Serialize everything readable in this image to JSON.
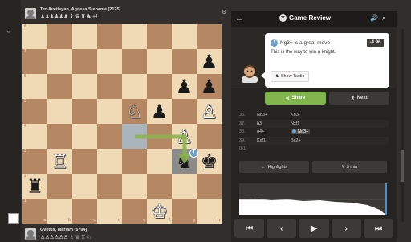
{
  "left_rail": {
    "mark": "«"
  },
  "player_top": {
    "name": "Ter-Avetisyan, Agnesa Stepania (2125)",
    "captures": "♟♟♟♟♟♟ ♝ ♛ ♜ ♞ +1"
  },
  "player_bottom": {
    "name": "Gvetus, Mariam (5794)",
    "captures": "♙♙♙♙♙♙ ♗ ♕ ♖ ♘"
  },
  "board": {
    "ranks": [
      "8",
      "7",
      "6",
      "5",
      "4",
      "3",
      "2",
      "1"
    ],
    "files": [
      "a",
      "b",
      "c",
      "d",
      "e",
      "f",
      "g",
      "h"
    ],
    "pieces": [
      {
        "sq": "h7",
        "glyph": "♟",
        "color": "b"
      },
      {
        "sq": "g6",
        "glyph": "♟",
        "color": "b"
      },
      {
        "sq": "h6",
        "glyph": "♟",
        "color": "b"
      },
      {
        "sq": "e5",
        "glyph": "♘",
        "color": "w"
      },
      {
        "sq": "f5",
        "glyph": "♟",
        "color": "b"
      },
      {
        "sq": "h5",
        "glyph": "♙",
        "color": "w"
      },
      {
        "sq": "g4",
        "glyph": "♙",
        "color": "w"
      },
      {
        "sq": "b3",
        "glyph": "♖",
        "color": "w"
      },
      {
        "sq": "g3",
        "glyph": "♞",
        "color": "b"
      },
      {
        "sq": "h3",
        "glyph": "♚",
        "color": "b"
      },
      {
        "sq": "a2",
        "glyph": "♜",
        "color": "b"
      },
      {
        "sq": "f1",
        "glyph": "♔",
        "color": "w"
      }
    ],
    "highlight_from": "e4",
    "highlight_to": "g3",
    "badge": "!"
  },
  "panel": {
    "title": "Game Review",
    "review_icon": "★",
    "back": "←",
    "sound": "🔊",
    "search": "⌕",
    "coach": {
      "message": "Ng3+ is a great move",
      "icon": "!",
      "eval": "-4.96",
      "sub": "This is the way to win a knight.",
      "show_tactic": "Show Tactic"
    },
    "share_label": "Share",
    "next_label": "Next",
    "moves": [
      {
        "no": "35.",
        "w": "Nd3+",
        "b": "Kh3"
      },
      {
        "no": "37.",
        "w": "h3",
        "b": "Nxf1"
      },
      {
        "no": "38.",
        "w": "g4+",
        "b": "Ng3+"
      },
      {
        "no": "39.",
        "w": "Kxf1",
        "b": "Bc2+"
      },
      {
        "no": "0-1",
        "w": "",
        "b": ""
      }
    ],
    "highlights_label": "Highlights",
    "time_label": "3 min",
    "nav": [
      "⏮",
      "‹",
      "▶",
      "›",
      "⏭"
    ]
  },
  "colors": {
    "light_square": "#f0d9b5",
    "dark_square": "#b58863",
    "share_green": "#81b64c",
    "great_blue": "#6aa2cc"
  }
}
